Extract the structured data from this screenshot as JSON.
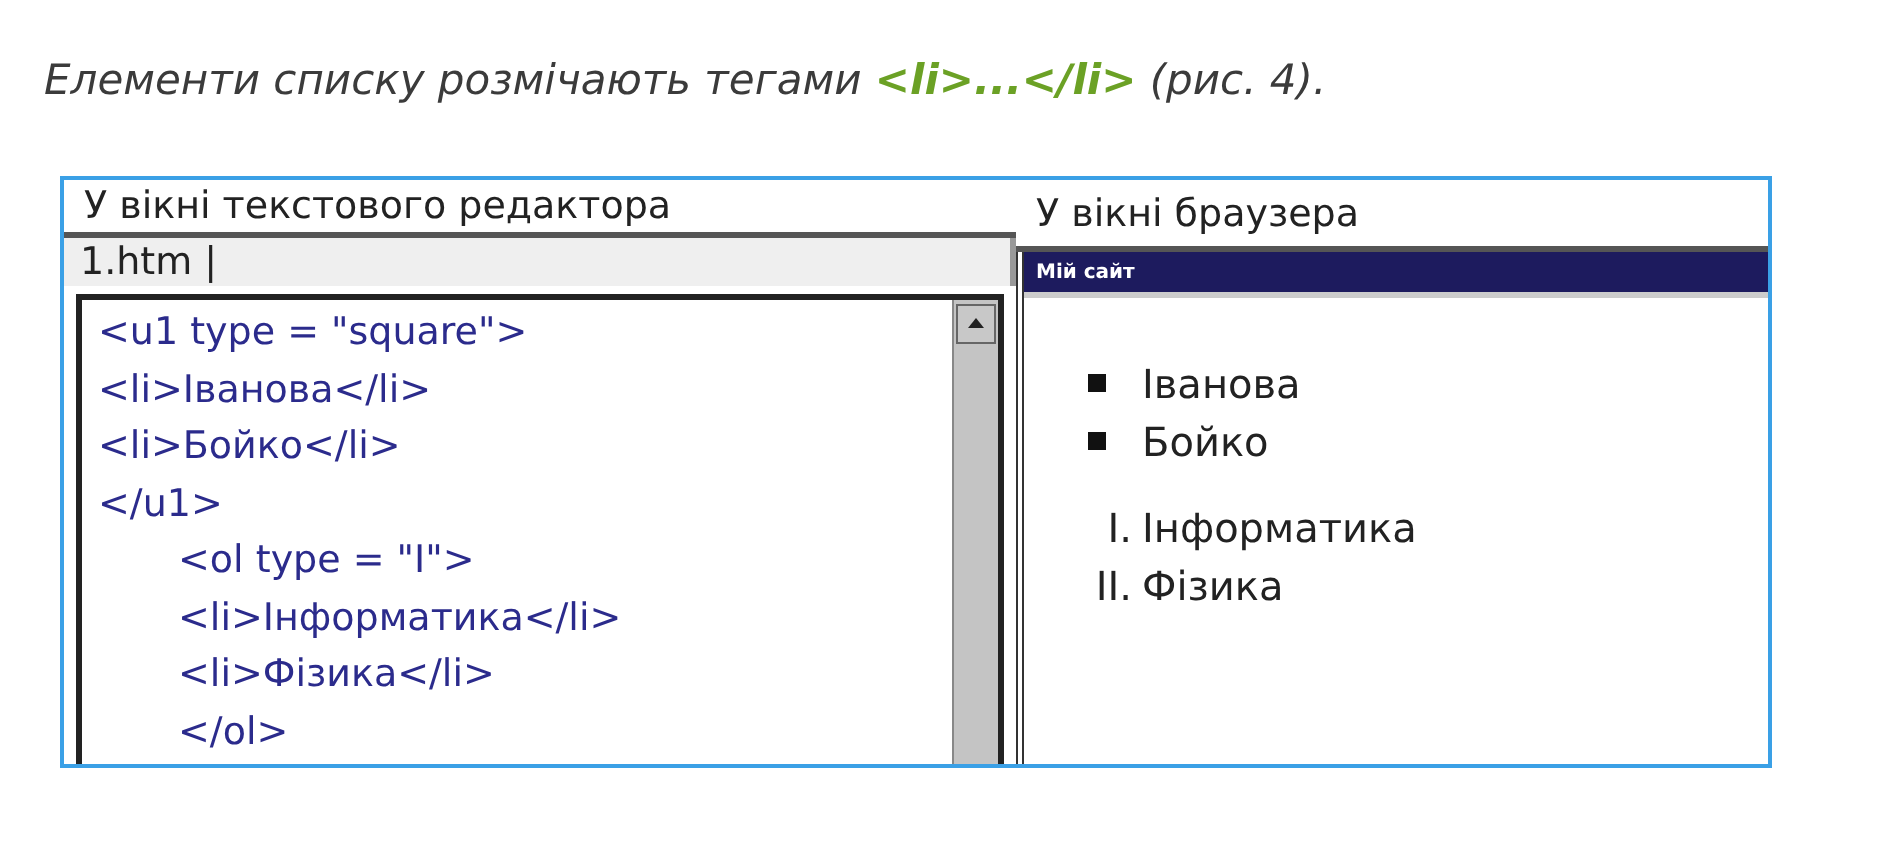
{
  "caption": [
    {
      "kind": "plain",
      "text": "Елементи списку розмічають тегами "
    },
    {
      "kind": "tag",
      "text": "<li>...</li>"
    },
    {
      "kind": "plain",
      "text": " (рис. 4)."
    }
  ],
  "editor": {
    "heading": "У вікні текстового редактора",
    "filename": "1.htm |",
    "lines": [
      {
        "text": "<u1 type = \"square\">"
      },
      {
        "text": "<li>Іванова</li>"
      },
      {
        "text": "<li>Бойко</li>"
      },
      {
        "text": "</u1>",
        "children": [
          {
            "text": "<ol type = \"I\">"
          },
          {
            "text": "<li>Інформатика</li>"
          },
          {
            "text": "<li>Фізика</li>"
          },
          {
            "text": "</ol>"
          }
        ]
      }
    ]
  },
  "browser": {
    "heading": "У вікні браузера",
    "title": "Мій сайт",
    "lists": [
      {
        "items": [
          {
            "kind": "bullet",
            "text": "Іванова"
          },
          {
            "kind": "bullet",
            "text": "Бойко"
          }
        ]
      },
      {
        "items": [
          {
            "kind": "numbered",
            "marker": "I.",
            "text": "Інформатика"
          },
          {
            "kind": "numbered",
            "marker": "II.",
            "text": "Фізика"
          }
        ]
      }
    ]
  }
}
